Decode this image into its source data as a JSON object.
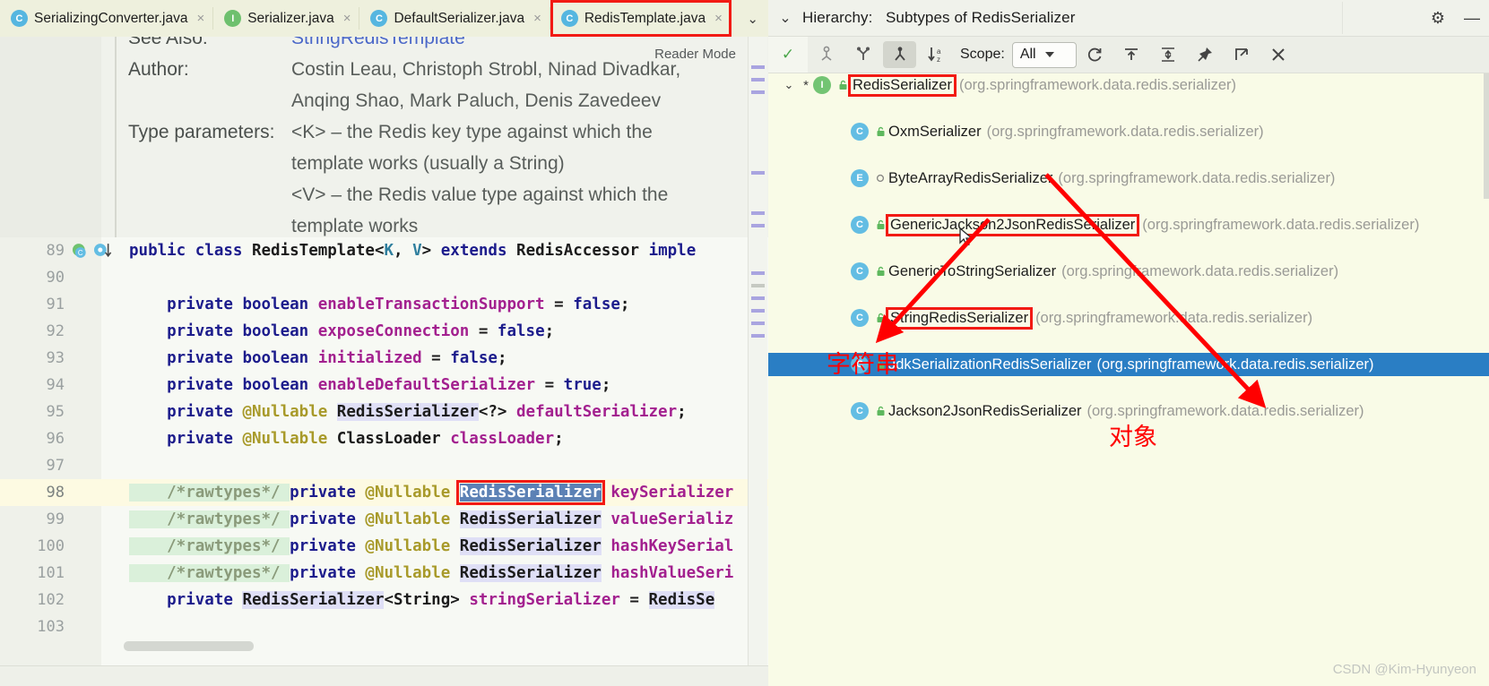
{
  "editor": {
    "tabs": [
      {
        "label": "SerializingConverter.java",
        "icon": "class-icon",
        "badge": "C",
        "active": false
      },
      {
        "label": "Serializer.java",
        "icon": "interface-icon",
        "badge": "I",
        "active": false
      },
      {
        "label": "DefaultSerializer.java",
        "icon": "class-icon",
        "badge": "C",
        "active": false
      },
      {
        "label": "RedisTemplate.java",
        "icon": "class-icon",
        "badge": "C",
        "active": true
      }
    ],
    "tab_close_glyph": "×",
    "tab_overflow_glyph": "⌄",
    "reader_mode_label": "Reader Mode",
    "reader_check_glyph": "✓",
    "javadoc": {
      "see_also_label": "See Also:",
      "see_also_value": "StringRedisTemplate",
      "author_label": "Author:",
      "author_line1": "Costin Leau, Christoph Strobl, Ninad Divadkar,",
      "author_line2": "Anqing Shao, Mark Paluch, Denis Zavedeev",
      "type_params_label": "Type parameters:",
      "type_params_line1": "<K> – the Redis key type against which the",
      "type_params_line2": "template works (usually a String)",
      "type_params_line3": "<V> – the Redis value type against which the",
      "type_params_line4": "template works"
    },
    "code_lines": [
      {
        "num": "89",
        "current": false,
        "gutter": "class-override-icons",
        "tokens": [
          {
            "t": "public ",
            "c": "kw"
          },
          {
            "t": "class ",
            "c": "kw"
          },
          {
            "t": "RedisTemplate",
            "c": "type"
          },
          {
            "t": "<",
            "c": "type"
          },
          {
            "t": "K",
            "c": "gen"
          },
          {
            "t": ", ",
            "c": "type"
          },
          {
            "t": "V",
            "c": "gen"
          },
          {
            "t": "> ",
            "c": "type"
          },
          {
            "t": "extends ",
            "c": "kw"
          },
          {
            "t": "RedisAccessor ",
            "c": "type"
          },
          {
            "t": "imple",
            "c": "kw"
          }
        ]
      },
      {
        "num": "90",
        "current": false,
        "gutter": "",
        "tokens": []
      },
      {
        "num": "91",
        "current": false,
        "gutter": "",
        "tokens": [
          {
            "t": "    private ",
            "c": "kw"
          },
          {
            "t": "boolean ",
            "c": "kw"
          },
          {
            "t": "enableTransactionSupport",
            "c": "fld"
          },
          {
            "t": " = ",
            "c": "type"
          },
          {
            "t": "false",
            "c": "lit"
          },
          {
            "t": ";",
            "c": "type"
          }
        ]
      },
      {
        "num": "92",
        "current": false,
        "gutter": "",
        "tokens": [
          {
            "t": "    private ",
            "c": "kw"
          },
          {
            "t": "boolean ",
            "c": "kw"
          },
          {
            "t": "exposeConnection",
            "c": "fld"
          },
          {
            "t": " = ",
            "c": "type"
          },
          {
            "t": "false",
            "c": "lit"
          },
          {
            "t": ";",
            "c": "type"
          }
        ]
      },
      {
        "num": "93",
        "current": false,
        "gutter": "",
        "tokens": [
          {
            "t": "    private ",
            "c": "kw"
          },
          {
            "t": "boolean ",
            "c": "kw"
          },
          {
            "t": "initialized",
            "c": "fld"
          },
          {
            "t": " = ",
            "c": "type"
          },
          {
            "t": "false",
            "c": "lit"
          },
          {
            "t": ";",
            "c": "type"
          }
        ]
      },
      {
        "num": "94",
        "current": false,
        "gutter": "",
        "tokens": [
          {
            "t": "    private ",
            "c": "kw"
          },
          {
            "t": "boolean ",
            "c": "kw"
          },
          {
            "t": "enableDefaultSerializer",
            "c": "fld"
          },
          {
            "t": " = ",
            "c": "type"
          },
          {
            "t": "true",
            "c": "lit"
          },
          {
            "t": ";",
            "c": "type"
          }
        ]
      },
      {
        "num": "95",
        "current": false,
        "gutter": "",
        "tokens": [
          {
            "t": "    private ",
            "c": "kw"
          },
          {
            "t": "@Nullable ",
            "c": "ann"
          },
          {
            "t": "RedisSerializer",
            "c": "type hl-soft"
          },
          {
            "t": "<?> ",
            "c": "type"
          },
          {
            "t": "defaultSerializer",
            "c": "fld"
          },
          {
            "t": ";",
            "c": "type"
          }
        ]
      },
      {
        "num": "96",
        "current": false,
        "gutter": "",
        "tokens": [
          {
            "t": "    private ",
            "c": "kw"
          },
          {
            "t": "@Nullable ",
            "c": "ann"
          },
          {
            "t": "ClassLoader ",
            "c": "type"
          },
          {
            "t": "classLoader",
            "c": "fld"
          },
          {
            "t": ";",
            "c": "type"
          }
        ]
      },
      {
        "num": "97",
        "current": false,
        "gutter": "",
        "tokens": []
      },
      {
        "num": "98",
        "current": true,
        "gutter": "",
        "tokens": [
          {
            "t": "    /*rawtypes*/ ",
            "c": "cmt hl-green"
          },
          {
            "t": "private ",
            "c": "kw"
          },
          {
            "t": "@Nullable ",
            "c": "ann"
          },
          {
            "t": "RedisSerializer",
            "c": "hl-sel boxed"
          },
          {
            "t": " keySerializer",
            "c": "fld"
          }
        ]
      },
      {
        "num": "99",
        "current": false,
        "gutter": "",
        "tokens": [
          {
            "t": "    /*rawtypes*/ ",
            "c": "cmt hl-green"
          },
          {
            "t": "private ",
            "c": "kw"
          },
          {
            "t": "@Nullable ",
            "c": "ann"
          },
          {
            "t": "RedisSerializer",
            "c": "type hl-soft"
          },
          {
            "t": " valueSerializ",
            "c": "fld"
          }
        ]
      },
      {
        "num": "100",
        "current": false,
        "gutter": "",
        "tokens": [
          {
            "t": "    /*rawtypes*/ ",
            "c": "cmt hl-green"
          },
          {
            "t": "private ",
            "c": "kw"
          },
          {
            "t": "@Nullable ",
            "c": "ann"
          },
          {
            "t": "RedisSerializer",
            "c": "type hl-soft"
          },
          {
            "t": " hashKeySerial",
            "c": "fld"
          }
        ]
      },
      {
        "num": "101",
        "current": false,
        "gutter": "",
        "tokens": [
          {
            "t": "    /*rawtypes*/ ",
            "c": "cmt hl-green"
          },
          {
            "t": "private ",
            "c": "kw"
          },
          {
            "t": "@Nullable ",
            "c": "ann"
          },
          {
            "t": "RedisSerializer",
            "c": "type hl-soft"
          },
          {
            "t": " hashValueSeri",
            "c": "fld"
          }
        ]
      },
      {
        "num": "102",
        "current": false,
        "gutter": "",
        "tokens": [
          {
            "t": "    private ",
            "c": "kw"
          },
          {
            "t": "RedisSerializer",
            "c": "type hl-soft"
          },
          {
            "t": "<String> ",
            "c": "type"
          },
          {
            "t": "stringSerializer",
            "c": "fld"
          },
          {
            "t": " = ",
            "c": "type"
          },
          {
            "t": "RedisSe",
            "c": "type hl-soft"
          }
        ]
      },
      {
        "num": "103",
        "current": false,
        "gutter": "",
        "tokens": []
      }
    ]
  },
  "hierarchy": {
    "title_prefix": "Hierarchy:",
    "title_value": "Subtypes of RedisSerializer",
    "collapse_glyph": "⌄",
    "gear_glyph": "⚙",
    "minimize_glyph": "—",
    "toolbar": {
      "check_glyph": "✓",
      "buttons": [
        {
          "name": "type-hierarchy-button",
          "active": false
        },
        {
          "name": "supertypes-hierarchy-button",
          "active": false
        },
        {
          "name": "subtypes-hierarchy-button",
          "active": true
        },
        {
          "name": "sort-alphabetically-button",
          "active": false
        }
      ],
      "scope_label": "Scope:",
      "scope_value": "All",
      "actions": [
        {
          "name": "refresh-icon"
        },
        {
          "name": "expand-all-icon"
        },
        {
          "name": "collapse-all-icon"
        },
        {
          "name": "pin-icon"
        },
        {
          "name": "open-in-editor-icon"
        },
        {
          "name": "close-icon"
        }
      ]
    },
    "tree": [
      {
        "indent": 0,
        "arrow": "⌄",
        "star": "*",
        "kind": "I",
        "name": "RedisSerializer",
        "pkg": "(org.springframework.data.redis.serializer)",
        "boxed": true,
        "selected": false,
        "lock": "package"
      },
      {
        "indent": 1,
        "arrow": "",
        "star": "",
        "kind": "C",
        "name": "OxmSerializer",
        "pkg": "(org.springframework.data.redis.serializer)",
        "boxed": false,
        "selected": false,
        "lock": "package"
      },
      {
        "indent": 1,
        "arrow": "",
        "star": "",
        "kind": "E",
        "name": "ByteArrayRedisSerializer",
        "pkg": "(org.springframework.data.redis.serializer)",
        "boxed": false,
        "selected": false,
        "lock": "private"
      },
      {
        "indent": 1,
        "arrow": "",
        "star": "",
        "kind": "C",
        "name": "GenericJackson2JsonRedisSerializer",
        "pkg": "(org.springframework.data.redis.serializer)",
        "boxed": true,
        "selected": false,
        "lock": "package"
      },
      {
        "indent": 1,
        "arrow": "",
        "star": "",
        "kind": "C",
        "name": "GenericToStringSerializer",
        "pkg": "(org.springframework.data.redis.serializer)",
        "boxed": false,
        "selected": false,
        "lock": "package"
      },
      {
        "indent": 1,
        "arrow": "",
        "star": "",
        "kind": "C",
        "name": "StringRedisSerializer",
        "pkg": "(org.springframework.data.redis.serializer)",
        "boxed": true,
        "selected": false,
        "lock": "package"
      },
      {
        "indent": 1,
        "arrow": "",
        "star": "",
        "kind": "C",
        "name": "JdkSerializationRedisSerializer",
        "pkg": "(org.springframework.data.redis.serializer)",
        "boxed": false,
        "selected": true,
        "lock": "package"
      },
      {
        "indent": 1,
        "arrow": "",
        "star": "",
        "kind": "C",
        "name": "Jackson2JsonRedisSerializer",
        "pkg": "(org.springframework.data.redis.serializer)",
        "boxed": false,
        "selected": false,
        "lock": "package"
      }
    ]
  },
  "annotations": {
    "string_label": "字符串",
    "object_label": "对象",
    "arrow_color": "#ff0000",
    "highlight_color": "#f21a14"
  },
  "watermark": "CSDN @Kim-Hyunyeon"
}
